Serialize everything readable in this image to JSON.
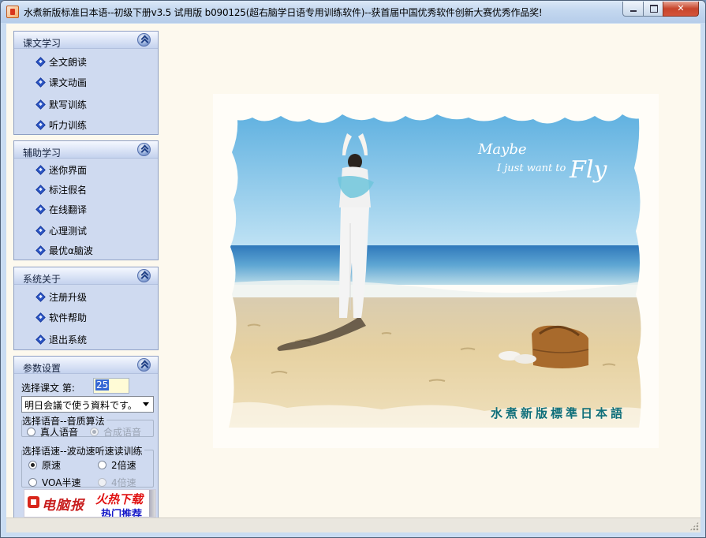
{
  "window": {
    "title": "水煮新版标准日本语--初级下册v3.5 试用版 b090125(超右脑学日语专用训练软件)--获首届中国优秀软件创新大赛优秀作品奖!",
    "buttons": {
      "minimize": "",
      "maximize": "",
      "close": "✕"
    }
  },
  "sidebar": {
    "lesson_study": {
      "title": "课文学习",
      "items": [
        "全文朗读",
        "课文动画",
        "默写训练",
        "听力训练"
      ]
    },
    "aux_study": {
      "title": "辅助学习",
      "items": [
        "迷你界面",
        "标注假名",
        "在线翻译",
        "心理测试",
        "最优α脑波"
      ]
    },
    "system": {
      "title": "系统关于",
      "items": [
        "注册升级",
        "软件帮助",
        "退出系统"
      ]
    },
    "params": {
      "title": "参数设置",
      "select_lesson_label": "选择课文  第:",
      "lesson_number": "25",
      "lesson_combo_value": "明日会議で使う資料です。",
      "voice_group_label": "选择语音--音质算法",
      "voice_options": [
        {
          "label": "真人语音",
          "selected": false,
          "enabled": true
        },
        {
          "label": "合成语音",
          "selected": true,
          "enabled": false
        }
      ],
      "speed_group_label": "选择语速--波动速听速读训练",
      "speed_options": [
        {
          "label": "原速",
          "selected": true,
          "enabled": true
        },
        {
          "label": "2倍速",
          "selected": false,
          "enabled": true
        },
        {
          "label": "VOA半速",
          "selected": false,
          "enabled": true
        },
        {
          "label": "4倍速",
          "selected": false,
          "enabled": false
        }
      ],
      "ad": {
        "brand": "电脑报",
        "hot": "火热下载",
        "sub": "热门推荐"
      }
    }
  },
  "photo": {
    "caption_maybe": "Maybe",
    "caption_line": "I just want to",
    "caption_fly": "Fly",
    "watermark": "水煮新版標準日本語",
    "colors": {
      "sky": "#6fb8e4",
      "sea": "#3f86c4",
      "sand": "#e9d5a9",
      "watermark": "#0f6f7a"
    }
  }
}
